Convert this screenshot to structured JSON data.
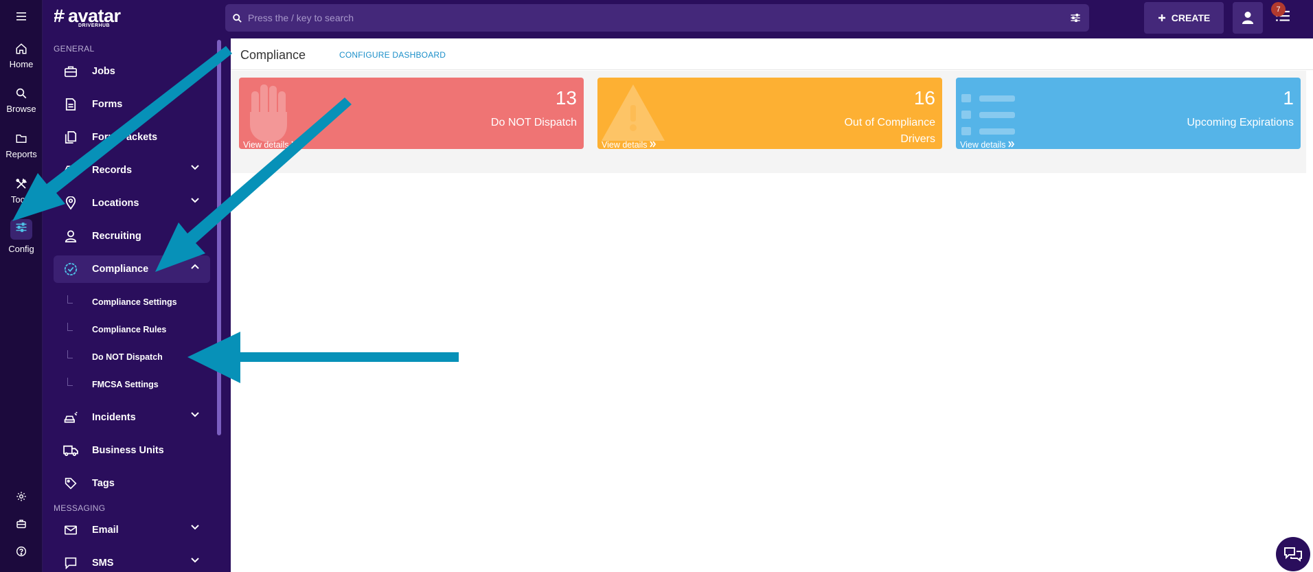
{
  "rail": {
    "menu_icon": "hamburger-icon",
    "items": [
      {
        "label": "Home",
        "icon": "home-icon"
      },
      {
        "label": "Browse",
        "icon": "search-icon"
      },
      {
        "label": "Reports",
        "icon": "folder-icon"
      },
      {
        "label": "Tools",
        "icon": "tools-icon"
      },
      {
        "label": "Config",
        "icon": "sliders-icon"
      }
    ],
    "bottom_icons": [
      "gear-icon",
      "briefcase-icon",
      "help-icon"
    ]
  },
  "logo": {
    "brand": "avatar",
    "sub": "DRIVERHUB"
  },
  "sidebar": {
    "general_label": "GENERAL",
    "messaging_label": "MESSAGING",
    "items": [
      {
        "label": "Jobs"
      },
      {
        "label": "Forms"
      },
      {
        "label": "Form Packets"
      },
      {
        "label": "Records"
      },
      {
        "label": "Locations"
      },
      {
        "label": "Recruiting"
      },
      {
        "label": "Compliance"
      },
      {
        "label": "Incidents"
      },
      {
        "label": "Business Units"
      },
      {
        "label": "Tags"
      },
      {
        "label": "Email"
      },
      {
        "label": "SMS"
      }
    ],
    "compliance_sub": [
      {
        "label": "Compliance Settings"
      },
      {
        "label": "Compliance Rules"
      },
      {
        "label": "Do NOT Dispatch"
      },
      {
        "label": "FMCSA Settings"
      }
    ]
  },
  "topbar": {
    "search_placeholder": "Press the / key to search",
    "create_label": "CREATE",
    "notification_count": "7"
  },
  "main": {
    "title": "Compliance",
    "configure_label": "CONFIGURE DASHBOARD",
    "cards": [
      {
        "count": "13",
        "label": "Do NOT Dispatch",
        "link": "View details",
        "color": "#ef7474",
        "icon": "hand-stop-icon"
      },
      {
        "count": "16",
        "label_line1": "Out of Compliance",
        "label_line2": "Drivers",
        "link": "View details",
        "color": "#fdb033",
        "icon": "warning-icon"
      },
      {
        "count": "1",
        "label": "Upcoming Expirations",
        "link": "View details",
        "color": "#55b4e8",
        "icon": "list-icon"
      }
    ]
  },
  "colors": {
    "sidebar_bg": "#2a0e5c",
    "rail_bg": "#1c0a3d",
    "accent_link": "#1b8fc9",
    "arrow": "#0791b8"
  }
}
